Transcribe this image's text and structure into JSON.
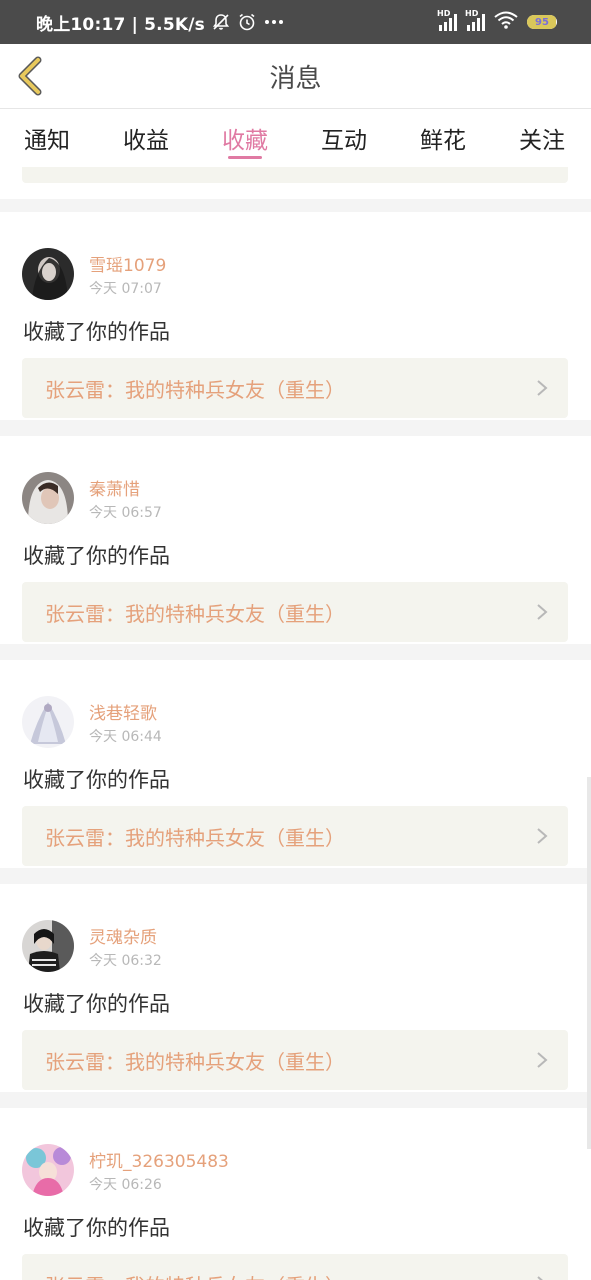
{
  "status_bar": {
    "time_text": "晚上10:17 | 5.5K/s",
    "network_1": "HD",
    "network_2": "HD",
    "battery": "95",
    "battery_level": 0.95,
    "icons": [
      "mute-bell-icon",
      "alarm-icon",
      "more-dots-icon",
      "signal-icon",
      "wifi-icon",
      "battery-icon"
    ]
  },
  "header": {
    "title": "消息",
    "back_icon": "chevron-left-icon"
  },
  "tabs": [
    {
      "label": "通知",
      "active": false
    },
    {
      "label": "收益",
      "active": false
    },
    {
      "label": "收藏",
      "active": true
    },
    {
      "label": "互动",
      "active": false
    },
    {
      "label": "鲜花",
      "active": false
    },
    {
      "label": "关注",
      "active": false
    }
  ],
  "messages": [
    {
      "user": "雪瑶1079",
      "time": "今天 07:07",
      "action": "收藏了你的作品",
      "work": "张云雷：我的特种兵女友（重生）"
    },
    {
      "user": "秦萧惜",
      "time": "今天 06:57",
      "action": "收藏了你的作品",
      "work": "张云雷：我的特种兵女友（重生）"
    },
    {
      "user": "浅巷轻歌",
      "time": "今天 06:44",
      "action": "收藏了你的作品",
      "work": "张云雷：我的特种兵女友（重生）"
    },
    {
      "user": "灵魂杂质",
      "time": "今天 06:32",
      "action": "收藏了你的作品",
      "work": "张云雷：我的特种兵女友（重生）"
    },
    {
      "user": "柠玑_326305483",
      "time": "今天 06:26",
      "action": "收藏了你的作品",
      "work": "张云雷：我的特种兵女友（重生）"
    }
  ],
  "colors": {
    "accent_pink": "#e07aa3",
    "username_orange": "#e5a17b",
    "link_background": "#f4f4ee",
    "status_bar": "#4b4b4b",
    "back_arrow": "#e0c060"
  }
}
